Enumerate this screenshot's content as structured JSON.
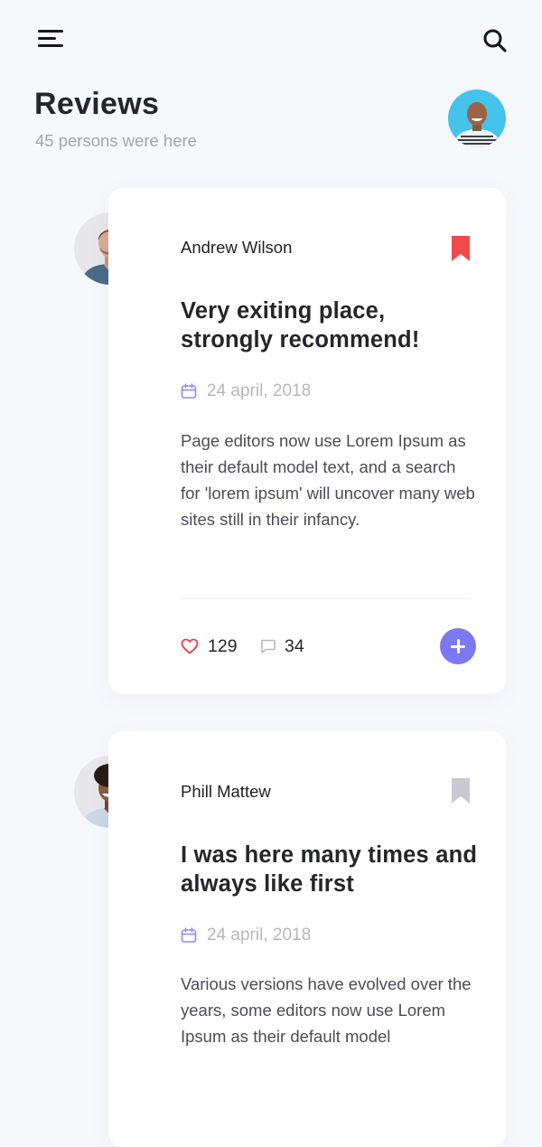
{
  "header": {
    "title": "Reviews",
    "subtitle": "45 persons were here"
  },
  "icons": {
    "menu": "menu-icon",
    "search": "search-icon",
    "bookmark": "bookmark-icon",
    "calendar": "calendar-icon",
    "heart": "heart-icon",
    "comment": "comment-icon",
    "plus": "plus-icon"
  },
  "colors": {
    "accent": "#7c78f2",
    "bookmark_active": "#f04a4a",
    "bookmark_inactive": "#c9c9d3",
    "heart": "#e0454f",
    "background": "#f7f8fc",
    "card": "#ffffff"
  },
  "reviews": [
    {
      "author": "Andrew Wilson",
      "bookmarked": true,
      "title": "Very exiting place, strongly recommend!",
      "date": "24 april, 2018",
      "body": "Page editors now use Lorem Ipsum as their default model text, and a search for 'lorem ipsum' will uncover many web sites still in their infancy.",
      "likes": "129",
      "comments": "34"
    },
    {
      "author": "Phill Mattew",
      "bookmarked": false,
      "title": "I was here many times and always like first",
      "date": "24 april, 2018",
      "body": "Various versions have evolved over the years, some editors now use Lorem Ipsum as their default model"
    }
  ]
}
